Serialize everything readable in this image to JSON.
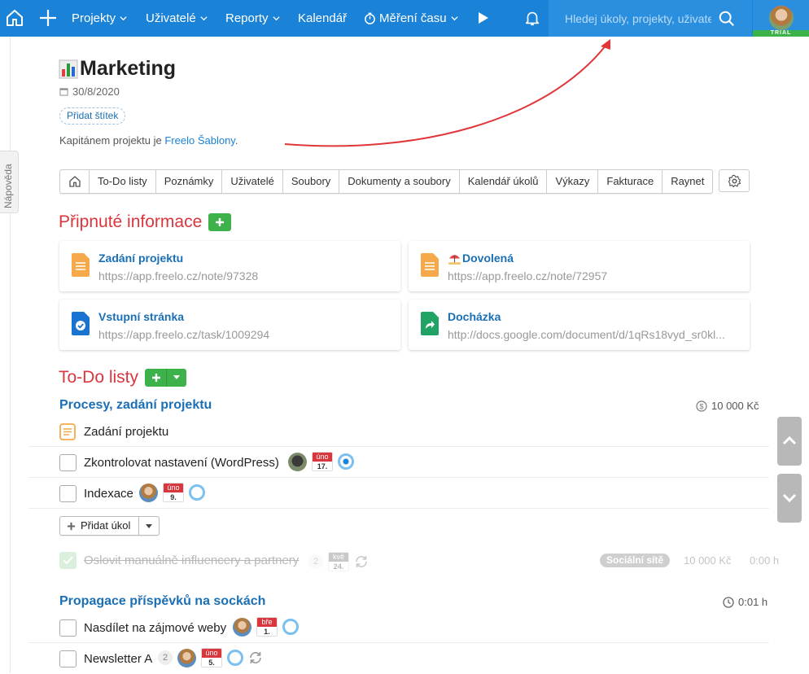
{
  "nav": {
    "items": [
      "Projekty",
      "Uživatelé",
      "Reporty",
      "Kalendář",
      "Měření času"
    ],
    "search_placeholder": "Hledej úkoly, projekty, uživatele",
    "trial_label": "TRIAL"
  },
  "sidebar_tab": "Nápověda",
  "project": {
    "title": "Marketing",
    "date": "30/8/2020",
    "add_tag": "Přidat štítek",
    "captain_prefix": "Kapitánem projektu je ",
    "captain_name": "Freelo Šablony",
    "captain_suffix": "."
  },
  "tabs": [
    "To-Do listy",
    "Poznámky",
    "Uživatelé",
    "Soubory",
    "Dokumenty a soubory",
    "Kalendář úkolů",
    "Výkazy",
    "Fakturace",
    "Raynet"
  ],
  "pinned": {
    "title": "Připnuté informace",
    "cards": [
      {
        "title": "Zadání projektu",
        "url": "https://app.freelo.cz/note/97328"
      },
      {
        "title": "Dovolená",
        "url": "https://app.freelo.cz/note/72957"
      },
      {
        "title": "Vstupní stránka",
        "url": "https://app.freelo.cz/task/1009294"
      },
      {
        "title": "Docházka",
        "url": "http://docs.google.com/document/d/1qRs18vyd_sr0kl..."
      }
    ]
  },
  "todo": {
    "title": "To-Do listy",
    "lists": [
      {
        "title": "Procesy, zadání projektu",
        "meta": "10 000 Kč",
        "note": "Zadání projektu",
        "tasks": [
          {
            "text": "Zkontrolovat nastavení (WordPress)",
            "month": "úno",
            "day": "17."
          },
          {
            "text": "Indexace",
            "month": "úno",
            "day": "9."
          }
        ],
        "add_task": "Přidat úkol",
        "done": {
          "text": "Oslovit manuálně influencery a partnery",
          "count": "2",
          "month": "kvě",
          "day": "24.",
          "tag": "Sociální sítě",
          "price": "10 000 Kč",
          "time": "0:00 h"
        }
      },
      {
        "title": "Propagace příspěvků na sockách",
        "meta": "0:01 h",
        "tasks": [
          {
            "text": "Nasdílet na zájmové weby",
            "month": "bře",
            "day": "1."
          },
          {
            "text": "Newsletter A",
            "count": "2",
            "month": "úno",
            "day": "5."
          }
        ]
      }
    ]
  }
}
